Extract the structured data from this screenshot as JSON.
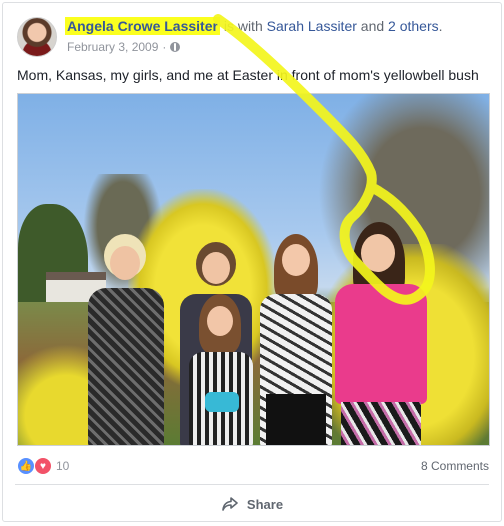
{
  "post": {
    "author": "Angela Crowe Lassiter",
    "with_text": "is with",
    "tagged_person": "Sarah Lassiter",
    "and_text": "and",
    "others": "2 others",
    "period": ".",
    "date": "February 3, 2009",
    "privacy_icon": "globe-icon",
    "text": "Mom, Kansas, my girls, and me at Easter in front of mom's yellowbell bush"
  },
  "photo": {
    "alt": "Family photo in front of forsythia bush"
  },
  "footer": {
    "reaction_icons": [
      "like-icon",
      "love-icon"
    ],
    "reaction_count": "10",
    "comments": "8 Comments",
    "share_label": "Share",
    "share_icon": "share-arrow-icon"
  },
  "annotation": {
    "color": "#f3f51c"
  },
  "colors": {
    "link": "#365899",
    "muted": "#90949c",
    "highlight": "#fbff1f"
  }
}
